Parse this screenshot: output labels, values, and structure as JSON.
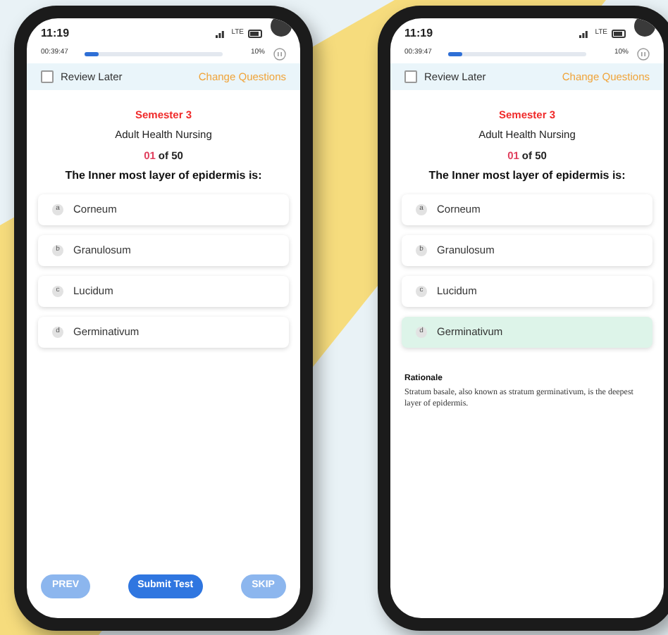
{
  "phones": [
    {
      "time": "11:19",
      "network": "LTE",
      "timer": "00:39:47",
      "progress": {
        "level": 0.1,
        "percent": "10%"
      },
      "review_later": {
        "label": "Review Later",
        "checked": false
      },
      "change_questions": "Change Questions",
      "semester": "Semester 3",
      "subject": "Adult Health Nursing",
      "counter": {
        "current": "01",
        "total": "of 50"
      },
      "question": "The Inner most layer of epidermis is:",
      "options": [
        {
          "letter": "a",
          "text": "Corneum",
          "selected": false
        },
        {
          "letter": "b",
          "text": "Granulosum",
          "selected": false
        },
        {
          "letter": "c",
          "text": "Lucidum",
          "selected": false
        },
        {
          "letter": "d",
          "text": "Germinativum",
          "selected": false
        }
      ],
      "buttons": [
        {
          "label": "PREV",
          "kind": "secondary"
        },
        {
          "label": "Submit Test",
          "kind": "primary"
        },
        {
          "label": "SKIP",
          "kind": "secondary"
        }
      ]
    },
    {
      "time": "11:19",
      "network": "LTE",
      "timer": "00:39:47",
      "progress": {
        "level": 0.1,
        "percent": "10%"
      },
      "review_later": {
        "label": "Review Later",
        "checked": false
      },
      "change_questions": "Change Questions",
      "semester": "Semester 3",
      "subject": "Adult Health Nursing",
      "counter": {
        "current": "01",
        "total": "of 50"
      },
      "question": "The Inner most layer of epidermis is:",
      "options": [
        {
          "letter": "a",
          "text": "Corneum",
          "selected": false
        },
        {
          "letter": "b",
          "text": "Granulosum",
          "selected": false
        },
        {
          "letter": "c",
          "text": "Lucidum",
          "selected": false
        },
        {
          "letter": "d",
          "text": "Germinativum",
          "selected": true
        }
      ],
      "rationale": {
        "title": "Rationale",
        "text": "Stratum basale, also known as stratum germinativum, is the deepest layer of epidermis."
      }
    }
  ]
}
